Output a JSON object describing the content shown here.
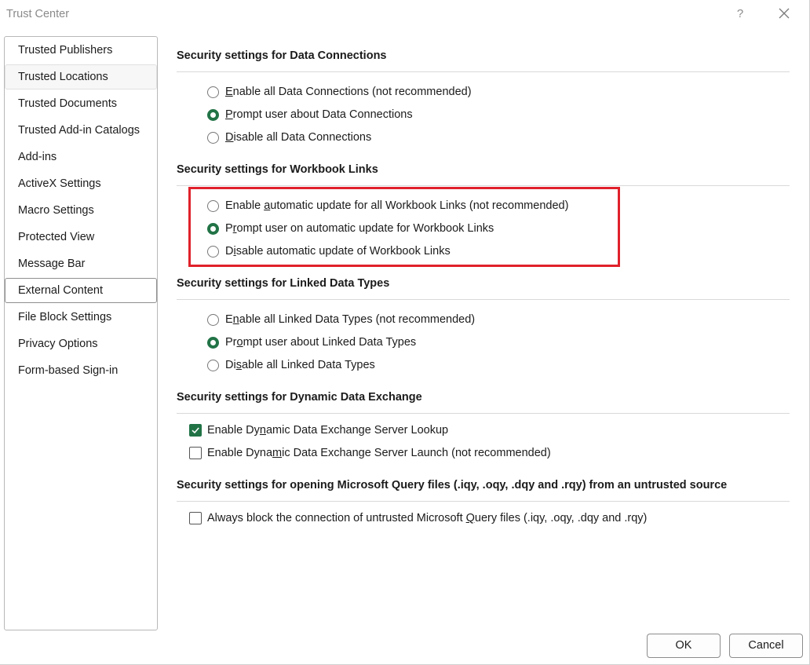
{
  "window": {
    "title": "Trust Center",
    "help_label": "?"
  },
  "sidebar": {
    "items": [
      {
        "label": "Trusted Publishers"
      },
      {
        "label": "Trusted Locations"
      },
      {
        "label": "Trusted Documents"
      },
      {
        "label": "Trusted Add-in Catalogs"
      },
      {
        "label": "Add-ins"
      },
      {
        "label": "ActiveX Settings"
      },
      {
        "label": "Macro Settings"
      },
      {
        "label": "Protected View"
      },
      {
        "label": "Message Bar"
      },
      {
        "label": "External Content"
      },
      {
        "label": "File Block Settings"
      },
      {
        "label": "Privacy Options"
      },
      {
        "label": "Form-based Sign-in"
      }
    ],
    "selected": "External Content",
    "hovered": "Trusted Locations"
  },
  "sections": {
    "data_connections": {
      "heading": "Security settings for Data Connections",
      "options": [
        {
          "pre": "",
          "key": "E",
          "post": "nable all Data Connections (not recommended)",
          "checked": false
        },
        {
          "pre": "",
          "key": "P",
          "post": "rompt user about Data Connections",
          "checked": true
        },
        {
          "pre": "",
          "key": "D",
          "post": "isable all Data Connections",
          "checked": false
        }
      ]
    },
    "workbook_links": {
      "heading": "Security settings for Workbook Links",
      "options": [
        {
          "pre": "Enable ",
          "key": "a",
          "post": "utomatic update for all Workbook Links (not recommended)",
          "checked": false
        },
        {
          "pre": "P",
          "key": "r",
          "post": "ompt user on automatic update for Workbook Links",
          "checked": true
        },
        {
          "pre": "D",
          "key": "i",
          "post": "sable automatic update of Workbook Links",
          "checked": false
        }
      ]
    },
    "linked_data_types": {
      "heading": "Security settings for Linked Data Types",
      "options": [
        {
          "pre": "E",
          "key": "n",
          "post": "able all Linked Data Types (not recommended)",
          "checked": false
        },
        {
          "pre": "Pr",
          "key": "o",
          "post": "mpt user about Linked Data Types",
          "checked": true
        },
        {
          "pre": "Di",
          "key": "s",
          "post": "able all Linked Data Types",
          "checked": false
        }
      ]
    },
    "dde": {
      "heading": "Security settings for Dynamic Data Exchange",
      "options": [
        {
          "pre": "Enable Dy",
          "key": "n",
          "post": "amic Data Exchange Server Lookup",
          "checked": true
        },
        {
          "pre": "Enable Dyna",
          "key": "m",
          "post": "ic Data Exchange Server Launch (not recommended)",
          "checked": false
        }
      ]
    },
    "query_files": {
      "heading": "Security settings for opening  Microsoft Query files (.iqy, .oqy, .dqy and .rqy) from an untrusted source",
      "options": [
        {
          "pre": "Always block the connection of untrusted Microsoft ",
          "key": "Q",
          "post": "uery files (.iqy, .oqy, .dqy and .rqy)",
          "checked": false
        }
      ]
    }
  },
  "buttons": {
    "ok": "OK",
    "cancel": "Cancel"
  },
  "colors": {
    "accent": "#217346",
    "highlight": "#e0212b"
  }
}
